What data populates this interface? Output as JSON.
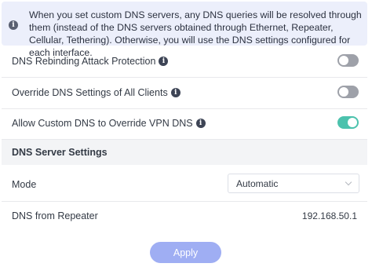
{
  "banner": {
    "icon": "info-icon",
    "text": "When you set custom DNS servers, any DNS queries will be resolved through them (instead of the DNS servers obtained through Ethernet, Repeater, Cellular, Tethering). Otherwise, you will use the DNS settings configured for each interface."
  },
  "settings": {
    "rebinding": {
      "label": "DNS Rebinding Attack Protection",
      "enabled": false
    },
    "override_clients": {
      "label": "Override DNS Settings of All Clients",
      "enabled": false
    },
    "custom_vpn": {
      "label": "Allow Custom DNS to Override VPN DNS",
      "enabled": true
    }
  },
  "section": {
    "title": "DNS Server Settings"
  },
  "mode": {
    "label": "Mode",
    "value": "Automatic"
  },
  "repeater": {
    "label": "DNS from Repeater",
    "value": "192.168.50.1"
  },
  "actions": {
    "apply_label": "Apply"
  },
  "colors": {
    "toggle_on": "#4cc2ad",
    "toggle_off": "#9ea1a9",
    "apply_button": "#9faef3",
    "banner_bg": "#eceffb"
  }
}
